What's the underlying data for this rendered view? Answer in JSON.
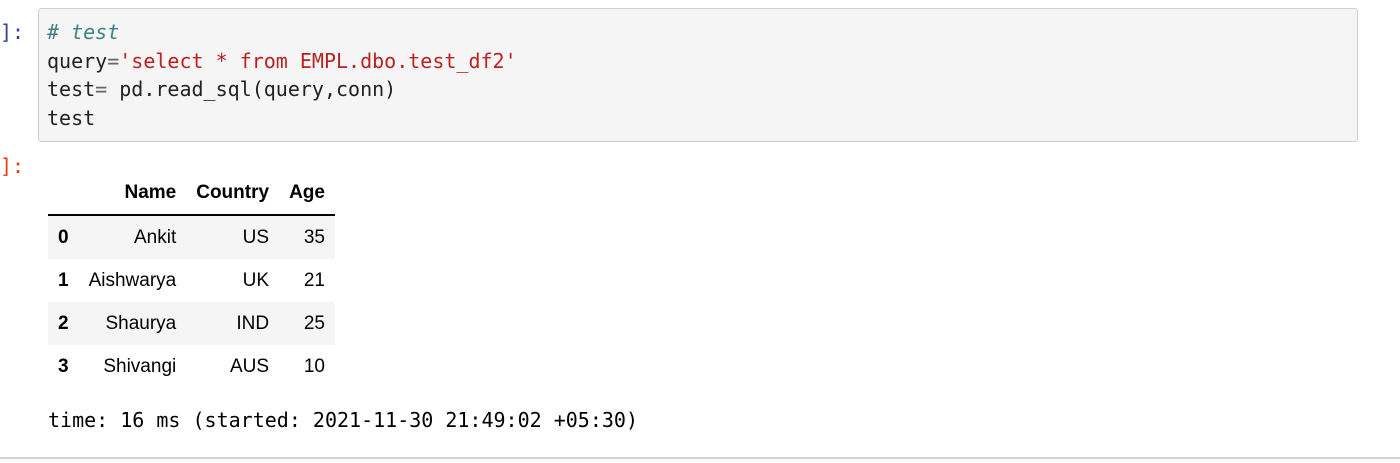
{
  "input_prompt": "]:",
  "output_prompt": "]:",
  "code": {
    "line1_comment": "# test",
    "line2_var": "query",
    "line2_op": "=",
    "line2_str": "'select * from EMPL.dbo.test_df2'",
    "line3_var": "test",
    "line3_op": "=",
    "line3_rest": " pd.read_sql(query,conn)",
    "line4": "test"
  },
  "table": {
    "index_header": "",
    "columns": [
      "Name",
      "Country",
      "Age"
    ],
    "rows": [
      {
        "index": "0",
        "name": "Ankit",
        "country": "US",
        "age": "35"
      },
      {
        "index": "1",
        "name": "Aishwarya",
        "country": "UK",
        "age": "21"
      },
      {
        "index": "2",
        "name": "Shaurya",
        "country": "IND",
        "age": "25"
      },
      {
        "index": "3",
        "name": "Shivangi",
        "country": "AUS",
        "age": "10"
      }
    ]
  },
  "timing": "time: 16 ms (started: 2021-11-30 21:49:02 +05:30)"
}
